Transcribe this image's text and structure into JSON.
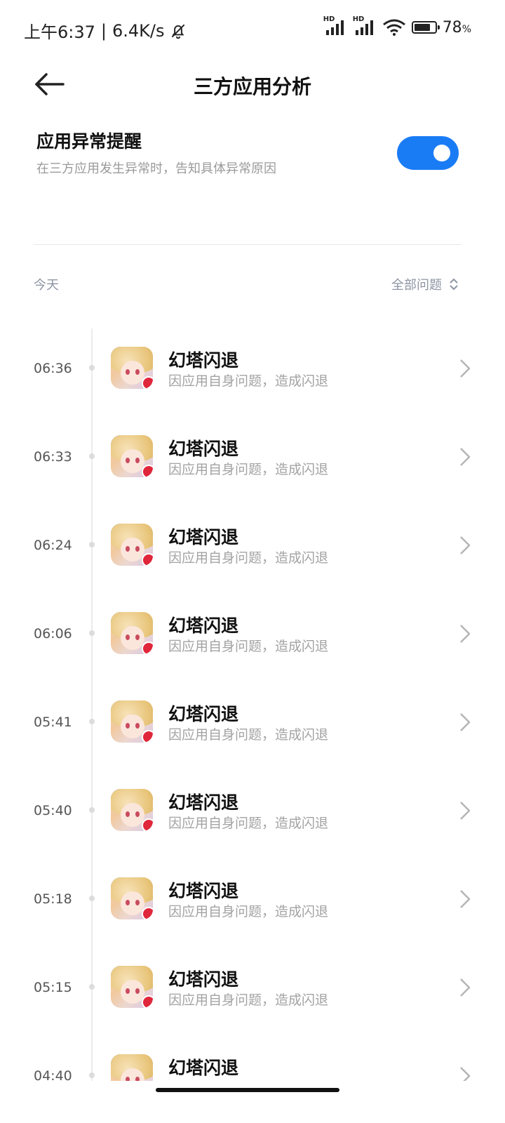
{
  "status_bar": {
    "time": "上午6:37",
    "separator": "|",
    "speed": "6.4K/s",
    "hd1": "HD",
    "hd2": "HD",
    "battery_level": 0.78,
    "battery_text": "78",
    "battery_unit": "%"
  },
  "header": {
    "title": "三方应用分析"
  },
  "setting": {
    "title": "应用异常提醒",
    "description": "在三方应用发生异常时，告知具体异常原因",
    "toggle_on": true,
    "accent_color": "#1a7cf5"
  },
  "filter": {
    "today_label": "今天",
    "select_label": "全部问题"
  },
  "events": [
    {
      "time": "06:36",
      "title": "幻塔闪退",
      "subtitle": "因应用自身问题，造成闪退"
    },
    {
      "time": "06:33",
      "title": "幻塔闪退",
      "subtitle": "因应用自身问题，造成闪退"
    },
    {
      "time": "06:24",
      "title": "幻塔闪退",
      "subtitle": "因应用自身问题，造成闪退"
    },
    {
      "time": "06:06",
      "title": "幻塔闪退",
      "subtitle": "因应用自身问题，造成闪退"
    },
    {
      "time": "05:41",
      "title": "幻塔闪退",
      "subtitle": "因应用自身问题，造成闪退"
    },
    {
      "time": "05:40",
      "title": "幻塔闪退",
      "subtitle": "因应用自身问题，造成闪退"
    },
    {
      "time": "05:18",
      "title": "幻塔闪退",
      "subtitle": "因应用自身问题，造成闪退"
    },
    {
      "time": "05:15",
      "title": "幻塔闪退",
      "subtitle": "因应用自身问题，造成闪退"
    },
    {
      "time": "04:40",
      "title": "幻塔闪退",
      "subtitle": ""
    }
  ]
}
